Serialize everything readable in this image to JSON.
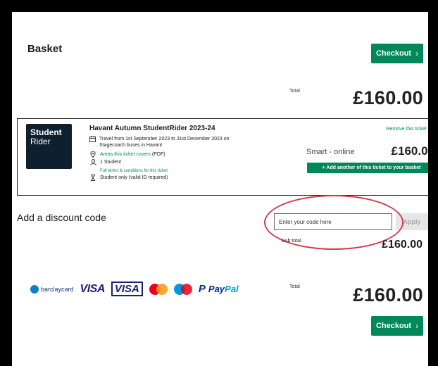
{
  "basket": {
    "title": "Basket",
    "checkout_label": "Checkout",
    "total_label": "Total",
    "total_value": "£160.00"
  },
  "ticket": {
    "logo_line1": "Student",
    "logo_line2": "Rider",
    "name": "Havant Autumn StudentRider 2023-24",
    "travel_text": "Travel from 1st September 2023 to 31st December 2023 on Stagecoach buses in Havant",
    "areas_link": "Areas this ticket covers",
    "areas_suffix": " (PDF)",
    "passengers": "1 Student",
    "terms_link": "Full terms & conditions for this ticket",
    "eligibility": "Student only (valid ID required)",
    "remove_label": "Remove this ticket",
    "format": "Smart - online",
    "price": "£160.00",
    "add_another_label": "+ Add another of this ticket to your basket"
  },
  "discount": {
    "title": "Add a discount code",
    "placeholder": "Enter your code here",
    "apply_label": "Apply",
    "subtotal_label": "Sub total",
    "subtotal_value": "£160.00"
  },
  "payment": {
    "barclaycard": "barclaycard",
    "visa": "VISA",
    "visa_debit": "VISA",
    "paypal_pay": "Pay",
    "paypal_pal": "Pal",
    "total_label": "Total",
    "total_value": "£160.00",
    "checkout_label": "Checkout"
  },
  "colors": {
    "brand_green": "#00875a",
    "logo_navy": "#0e1f2e",
    "highlight_red": "#d63a4b"
  },
  "icons": [
    "calendar-icon",
    "location-pin-icon",
    "person-icon",
    "hourglass-icon",
    "close-icon",
    "chevron-right-icon"
  ]
}
